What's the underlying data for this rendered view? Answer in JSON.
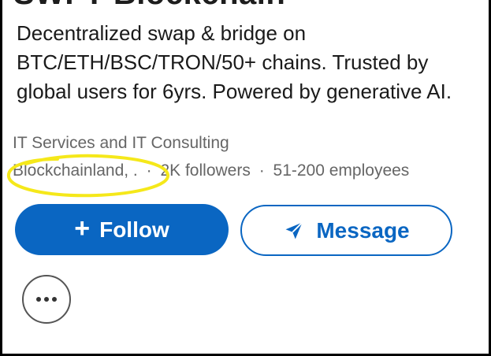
{
  "company": {
    "title_clipped": "SWFT Blockchain",
    "tagline": "Decentralized swap & bridge on BTC/ETH/BSC/TRON/50+ chains. Trusted by global users for 6yrs. Powered by generative AI.",
    "industry": "IT Services and IT Consulting",
    "location": "Blockchainland, .",
    "followers": "2K followers",
    "employees": "51-200 employees",
    "separator": "·"
  },
  "actions": {
    "follow_icon": "+",
    "follow_label": "Follow",
    "message_label": "Message",
    "message_icon": "send-icon",
    "more_icon": "more-options-icon"
  },
  "colors": {
    "brand_blue": "#0a66c2",
    "highlight_yellow": "#f5e81a",
    "muted_text": "#666666"
  }
}
